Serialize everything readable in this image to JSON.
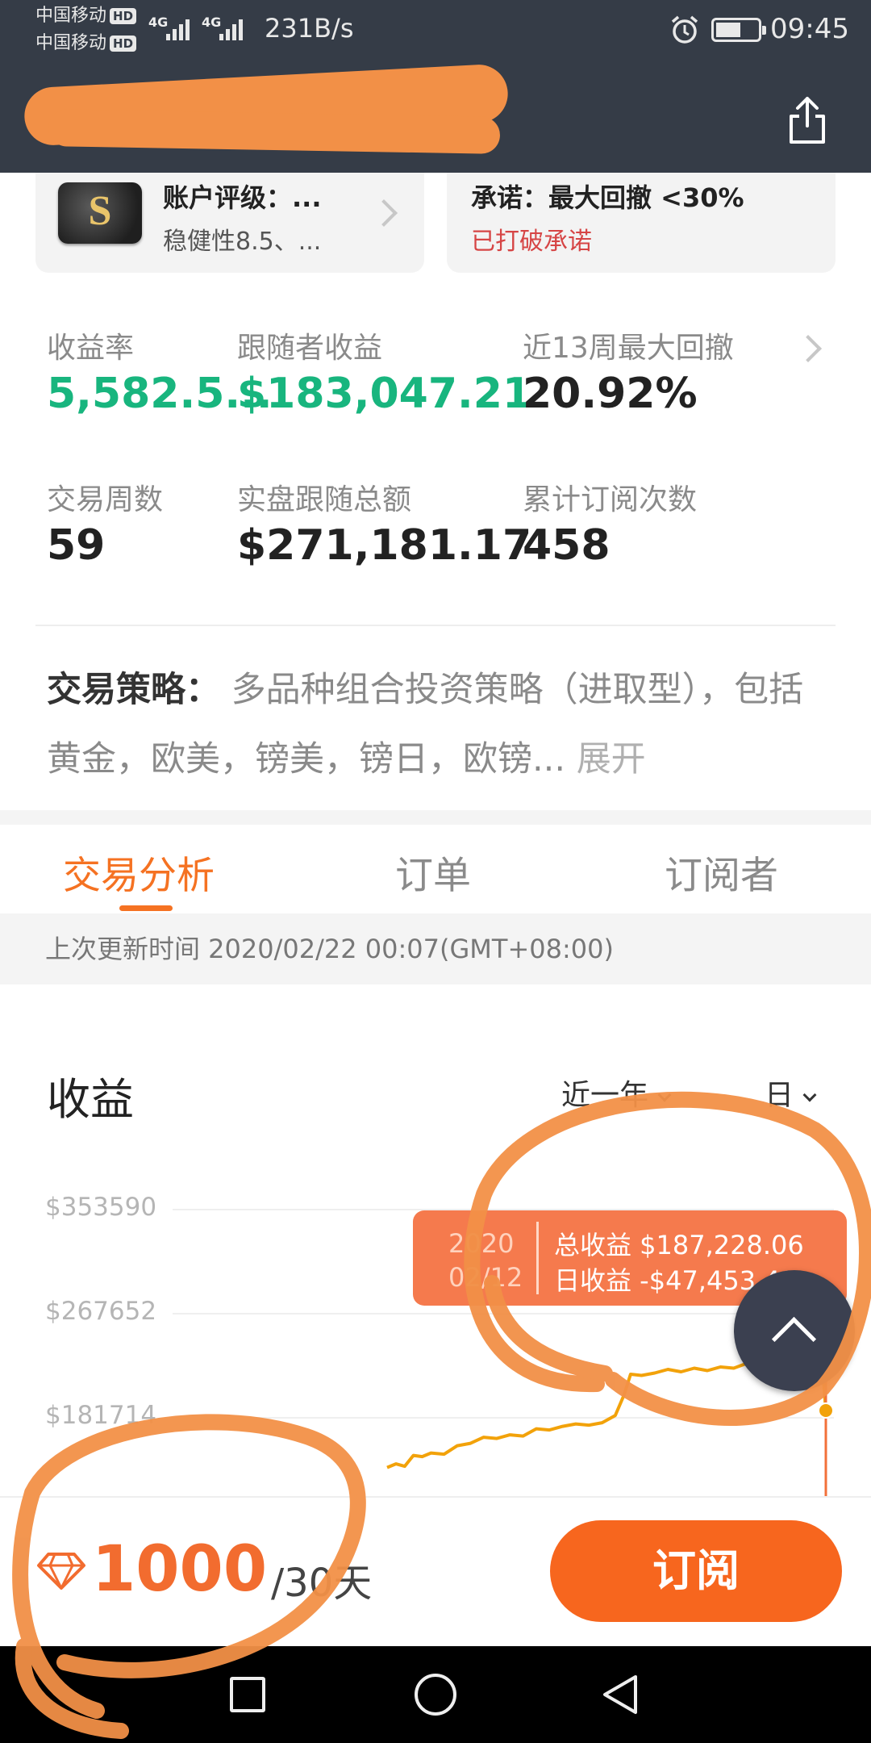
{
  "status_bar": {
    "carrier1": "中国移动",
    "carrier2": "中国移动",
    "hd": "HD",
    "network1": "4G",
    "network2": "4G",
    "speed": "231B/s",
    "time": "09:45",
    "battery_level": 0.6,
    "alarm_icon": "alarm-clock-icon"
  },
  "nav": {
    "back_icon": "back-arrow-icon",
    "share_icon": "share-icon",
    "title_redaction_color": "#f29047"
  },
  "cards": {
    "rating": {
      "badge": "S",
      "title": "账户评级：...",
      "subtitle": "稳健性8.5、..."
    },
    "promise": {
      "title": "承诺：最大回撤 <30%",
      "status": "已打破承诺",
      "status_color": "#d64545"
    }
  },
  "stats": [
    {
      "label": "收益率",
      "value": "5,582.5...",
      "color": "#18b57e"
    },
    {
      "label": "跟随者收益",
      "value": "$183,047.21",
      "color": "#18b57e"
    },
    {
      "label": "近13周最大回撤",
      "value": "20.92%"
    },
    {
      "label": "交易周数",
      "value": "59"
    },
    {
      "label": "实盘跟随总额",
      "value": "$271,181.17"
    },
    {
      "label": "累计订阅次数",
      "value": "458"
    }
  ],
  "strategy": {
    "label": "交易策略：",
    "text": "多品种组合投资策略（进取型），包括黄金，欧美，镑美，镑日，欧镑...",
    "expand": "展开"
  },
  "tabs": [
    {
      "label": "交易分析",
      "active": true
    },
    {
      "label": "订单"
    },
    {
      "label": "订阅者"
    }
  ],
  "last_updated": "上次更新时间 2020/02/22 00:07(GMT+08:00)",
  "chart": {
    "title": "收益",
    "range_select": "近一年",
    "interval_select": "日",
    "tooltip": {
      "date_line1": "2020",
      "date_line2": "02/12",
      "total_profit": "总收益 $187,228.06",
      "daily_profit": "日收益 -$47,453.41"
    },
    "accent_color": "#f2a20a"
  },
  "chart_data": {
    "type": "line",
    "title": "收益",
    "yticks": [
      "$353590",
      "$267652",
      "$181714"
    ],
    "series": [
      {
        "values": [
          [
            0.0,
            140000
          ],
          [
            0.02,
            143000
          ],
          [
            0.04,
            141000
          ],
          [
            0.06,
            150000
          ],
          [
            0.08,
            149000
          ],
          [
            0.1,
            152000
          ],
          [
            0.13,
            151000
          ],
          [
            0.16,
            158000
          ],
          [
            0.19,
            160000
          ],
          [
            0.22,
            165000
          ],
          [
            0.25,
            164000
          ],
          [
            0.28,
            167000
          ],
          [
            0.31,
            166000
          ],
          [
            0.34,
            172000
          ],
          [
            0.37,
            171000
          ],
          [
            0.4,
            174000
          ],
          [
            0.43,
            176000
          ],
          [
            0.46,
            175000
          ],
          [
            0.49,
            177000
          ],
          [
            0.52,
            183000
          ],
          [
            0.54,
            200000
          ],
          [
            0.555,
            217000
          ],
          [
            0.58,
            216000
          ],
          [
            0.61,
            218000
          ],
          [
            0.64,
            221000
          ],
          [
            0.67,
            219000
          ],
          [
            0.7,
            222000
          ],
          [
            0.73,
            220000
          ],
          [
            0.76,
            223000
          ],
          [
            0.79,
            222000
          ],
          [
            0.82,
            226000
          ],
          [
            0.85,
            224000
          ],
          [
            0.88,
            227000
          ],
          [
            0.91,
            225000
          ],
          [
            0.94,
            229000
          ],
          [
            0.97,
            230000
          ],
          [
            0.99,
            233000
          ],
          [
            1.0,
            187228
          ]
        ]
      }
    ]
  },
  "bottom": {
    "diamond_icon": "diamond-icon",
    "price": "1000",
    "period": "/30天",
    "subscribe": "订阅",
    "button_color": "#f7661e"
  },
  "system_nav": [
    "recent-apps-icon",
    "home-icon",
    "back-icon"
  ]
}
